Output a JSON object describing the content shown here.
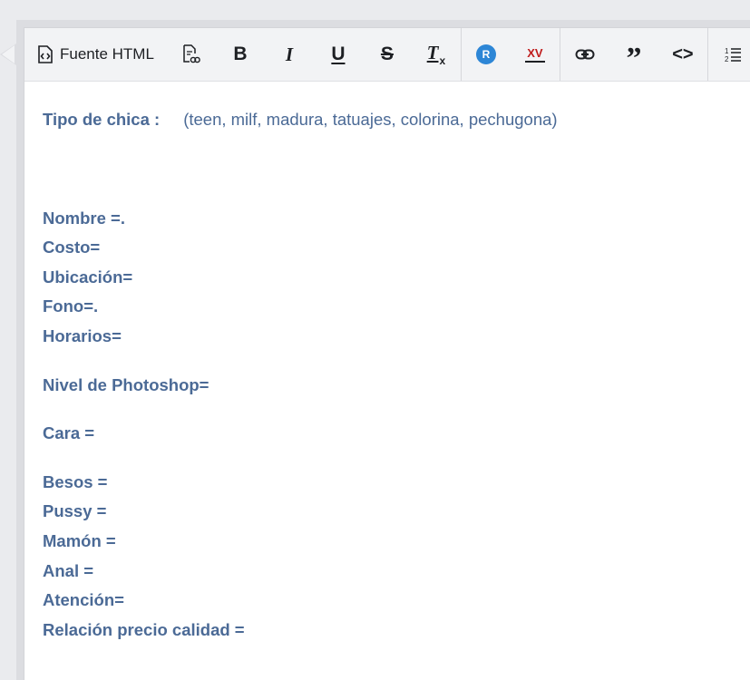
{
  "toolbar": {
    "source_label": "Fuente HTML",
    "buttons": [
      {
        "name": "source-icon"
      },
      {
        "name": "document-link-icon"
      },
      {
        "name": "bold",
        "glyph": "B"
      },
      {
        "name": "italic",
        "glyph": "I"
      },
      {
        "name": "underline",
        "glyph": "U"
      },
      {
        "name": "strikethrough",
        "glyph": "S"
      },
      {
        "name": "clear-format",
        "glyph": "T",
        "sub": "x"
      },
      {
        "name": "r-plugin",
        "glyph": "R"
      },
      {
        "name": "xv-plugin",
        "glyph": "XV"
      },
      {
        "name": "link-icon"
      },
      {
        "name": "quote",
        "glyph": "99"
      },
      {
        "name": "code",
        "glyph": "<>"
      },
      {
        "name": "numbered-list-icon",
        "glyph": "1 2"
      }
    ]
  },
  "content": {
    "tipo_label": "Tipo de chica :",
    "tipo_value": "(teen, milf, madura, tatuajes, colorina, pechugona)",
    "lines_group1": [
      "Nombre =.",
      "Costo=",
      "Ubicación=",
      "Fono=.",
      "Horarios="
    ],
    "photoshop": "Nivel de Photoshop=",
    "cara": "Cara =",
    "lines_group2": [
      "Besos =",
      "Pussy =",
      "Mamón =",
      "Anal =",
      "Atención="
    ],
    "relacion": "Relación precio calidad ="
  },
  "colors": {
    "text": "#4b6a96",
    "toolbar_bg": "#f2f3f5",
    "frame": "#dcdde1",
    "r_badge": "#2d86d6",
    "xv_text": "#c01d1d"
  }
}
